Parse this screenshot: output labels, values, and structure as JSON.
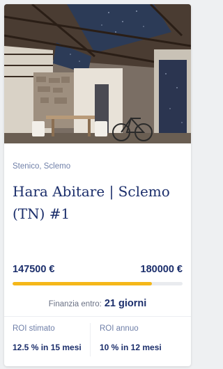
{
  "card": {
    "image_alt": "Interior with sloped wooden ceiling, skylights, stone wall, dining table and bicycle",
    "location": "Stenico, Sclemo",
    "title": "Hara Abitare | Sclemo (TN) #1",
    "raised_amount": "147500 €",
    "target_amount": "180000 €",
    "progress_fraction": 0.82,
    "finance_label": "Finanzia entro:",
    "finance_value": "21 giorni",
    "roi_estimated_label": "ROI stimato",
    "roi_estimated_value": "12.5 % in 15 mesi",
    "roi_annual_label": "ROI annuo",
    "roi_annual_value": "10 % in 12 mesi"
  },
  "colors": {
    "navy": "#1b2e6b",
    "muted_blue": "#6f7fa8",
    "progress_yellow": "#f5b719",
    "track": "#e9ebef"
  }
}
